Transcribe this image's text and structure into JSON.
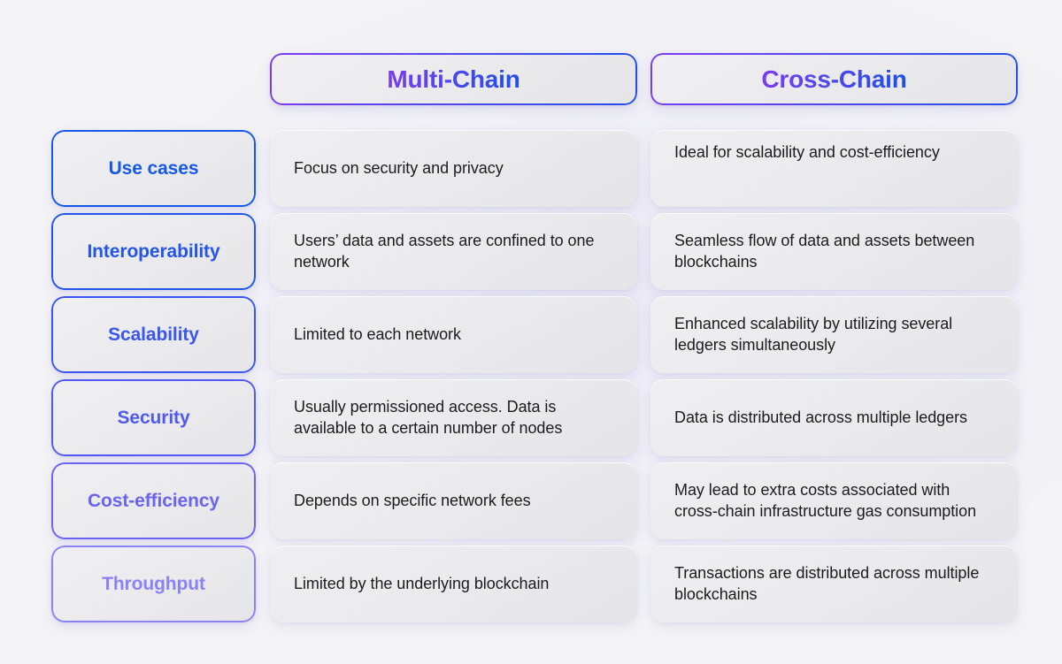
{
  "theme": {
    "page_background": "#f4f4f6",
    "card_background": "#eaeaec",
    "text_color": "#1c1c20",
    "accent_purple": "#7c3bf0",
    "accent_blue": "#1f4fe8"
  },
  "table": {
    "columns": [
      {
        "id": "criteria",
        "label": ""
      },
      {
        "id": "multi_chain",
        "label": "Multi-Chain",
        "accent": "#5546ee"
      },
      {
        "id": "cross_chain",
        "label": "Cross-Chain",
        "accent": "#5546ee"
      }
    ],
    "rows": [
      {
        "label": "Use cases",
        "label_color": "#1558ea",
        "multi_chain": "Focus on security and privacy",
        "cross_chain": "Ideal for scalability and cost-efficiency",
        "multi_align": "center",
        "cross_align": "top"
      },
      {
        "label": "Interoperability",
        "label_color": "#2355ea",
        "multi_chain": "Users’ data and assets are confined to one network",
        "cross_chain": "Seamless flow of data and assets between blockchains",
        "multi_align": "center",
        "cross_align": "center"
      },
      {
        "label": "Scalability",
        "label_color": "#3a56f0",
        "multi_chain": "Limited to each network",
        "cross_chain": "Enhanced scalability by utilizing several ledgers simultaneously",
        "multi_align": "center",
        "cross_align": "center"
      },
      {
        "label": "Security",
        "label_color": "#5059f2",
        "multi_chain": "Usually permissioned access. Data is available to a certain number of nodes",
        "cross_chain": "Data is distributed across multiple ledgers",
        "multi_align": "center",
        "cross_align": "center"
      },
      {
        "label": "Cost-efficiency",
        "label_color": "#6a63f3",
        "multi_chain": "Depends on specific network fees",
        "cross_chain": "May lead to extra costs associated with cross-chain infrastructure gas consumption",
        "multi_align": "center",
        "cross_align": "center"
      },
      {
        "label": "Throughput",
        "label_color": "#8b82f5",
        "multi_chain": "Limited by the underlying blockchain",
        "cross_chain": "Transactions are distributed across multiple blockchains",
        "multi_align": "center",
        "cross_align": "center"
      }
    ]
  }
}
